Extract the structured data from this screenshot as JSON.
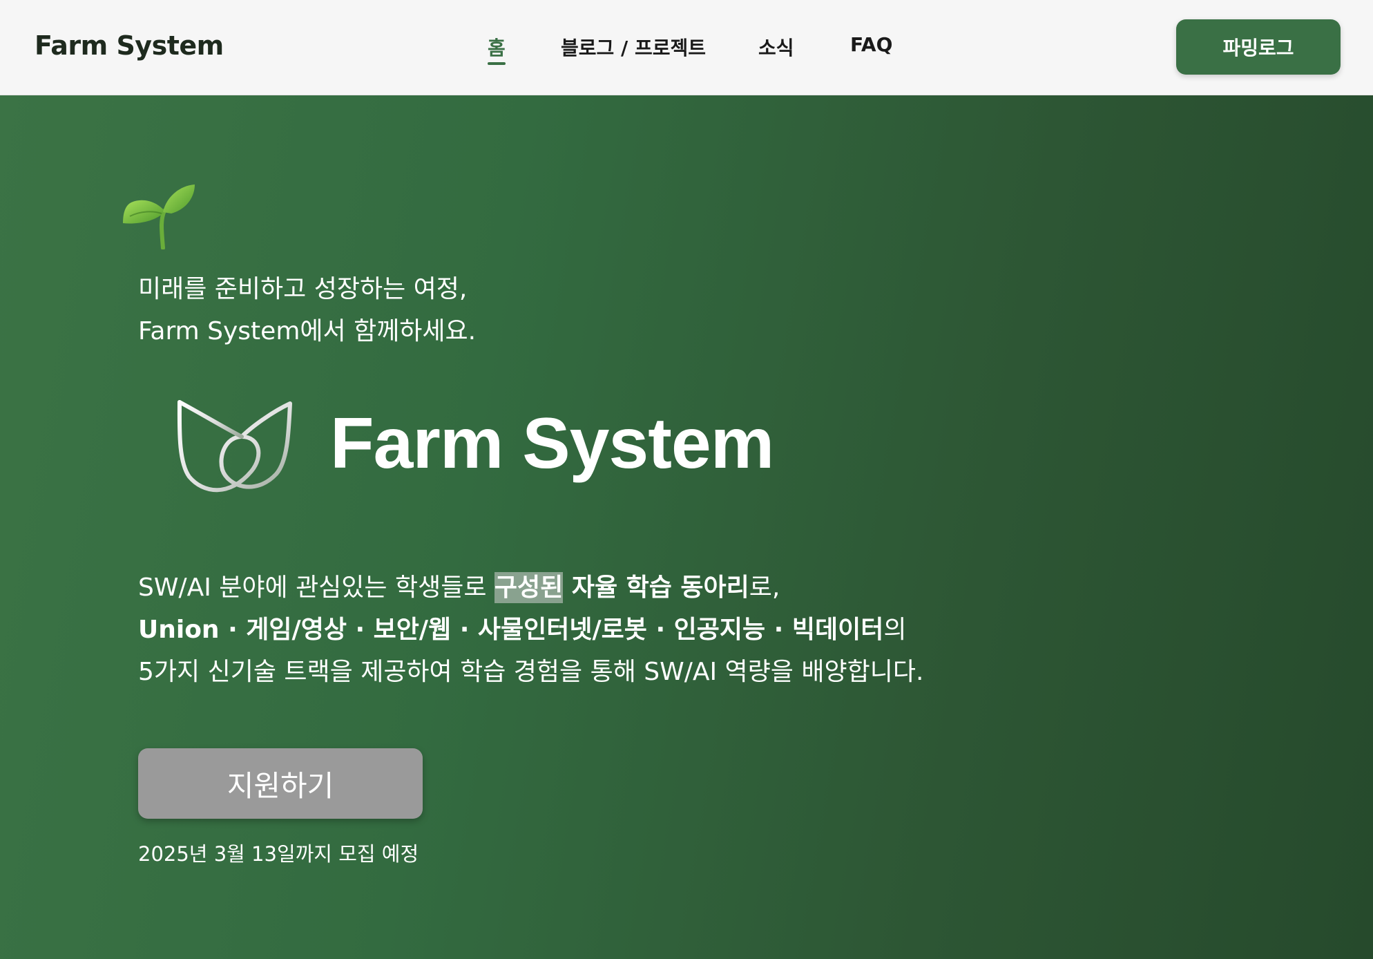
{
  "header": {
    "logo": "Farm System",
    "nav": [
      {
        "label": "홈",
        "active": true
      },
      {
        "label": "블로그 / 프로젝트",
        "active": false
      },
      {
        "label": "소식",
        "active": false
      },
      {
        "label": "FAQ",
        "active": false
      }
    ],
    "cta_label": "파밍로그"
  },
  "hero": {
    "sprout_icon": "seedling-icon",
    "tagline_line1": "미래를 준비하고 성장하는 여정,",
    "tagline_line2": "Farm System에서 함께하세요.",
    "brand_mark_icon": "leaf-outline-logo-icon",
    "brand_title": "Farm System",
    "desc_line1_a": "SW/AI 분야에 관심있는 학생들로 ",
    "desc_line1_hl": "구성된",
    "desc_line1_b": " 자율 학습 동아리",
    "desc_line1_c": "로,",
    "desc_line2_a": "Union · 게임/영상 · 보안/웹 · 사물인터넷/로봇 · 인공지능 · 빅데이터",
    "desc_line2_b": "의",
    "desc_line3": "5가지 신기술 트랙을 제공하여 학습 경험을 통해 SW/AI 역량을 배양합니다.",
    "apply_label": "지원하기",
    "deadline": "2025년 3월 13일까지 모집 예정"
  },
  "colors": {
    "brand_green": "#3a7045",
    "hero_start": "#3b7345",
    "hero_end": "#264a2c",
    "apply_button": "#9a9a9a"
  }
}
